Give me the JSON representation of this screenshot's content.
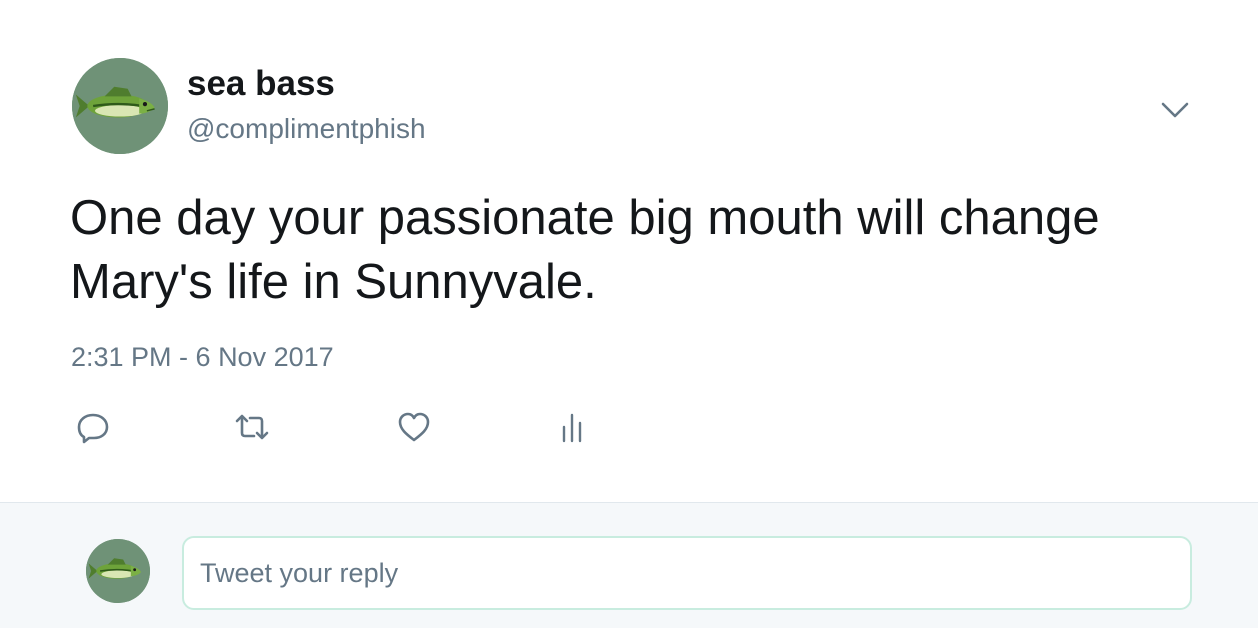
{
  "tweet": {
    "display_name": "sea bass",
    "handle": "@complimentphish",
    "text": "One day your passionate big mouth will change Mary's life in Sunnyvale.",
    "timestamp": "2:31 PM - 6 Nov 2017"
  },
  "icons": {
    "avatar": "fish-icon",
    "menu": "chevron-down-icon",
    "reply": "reply-icon",
    "retweet": "retweet-icon",
    "like": "heart-icon",
    "analytics": "analytics-icon"
  },
  "reply_box": {
    "placeholder": "Tweet your reply"
  },
  "colors": {
    "text_primary": "#14171a",
    "text_secondary": "#657786",
    "reply_bar_bg": "#f5f8fa",
    "input_border": "#c8ecdf",
    "avatar_bg": "#6f9277"
  }
}
